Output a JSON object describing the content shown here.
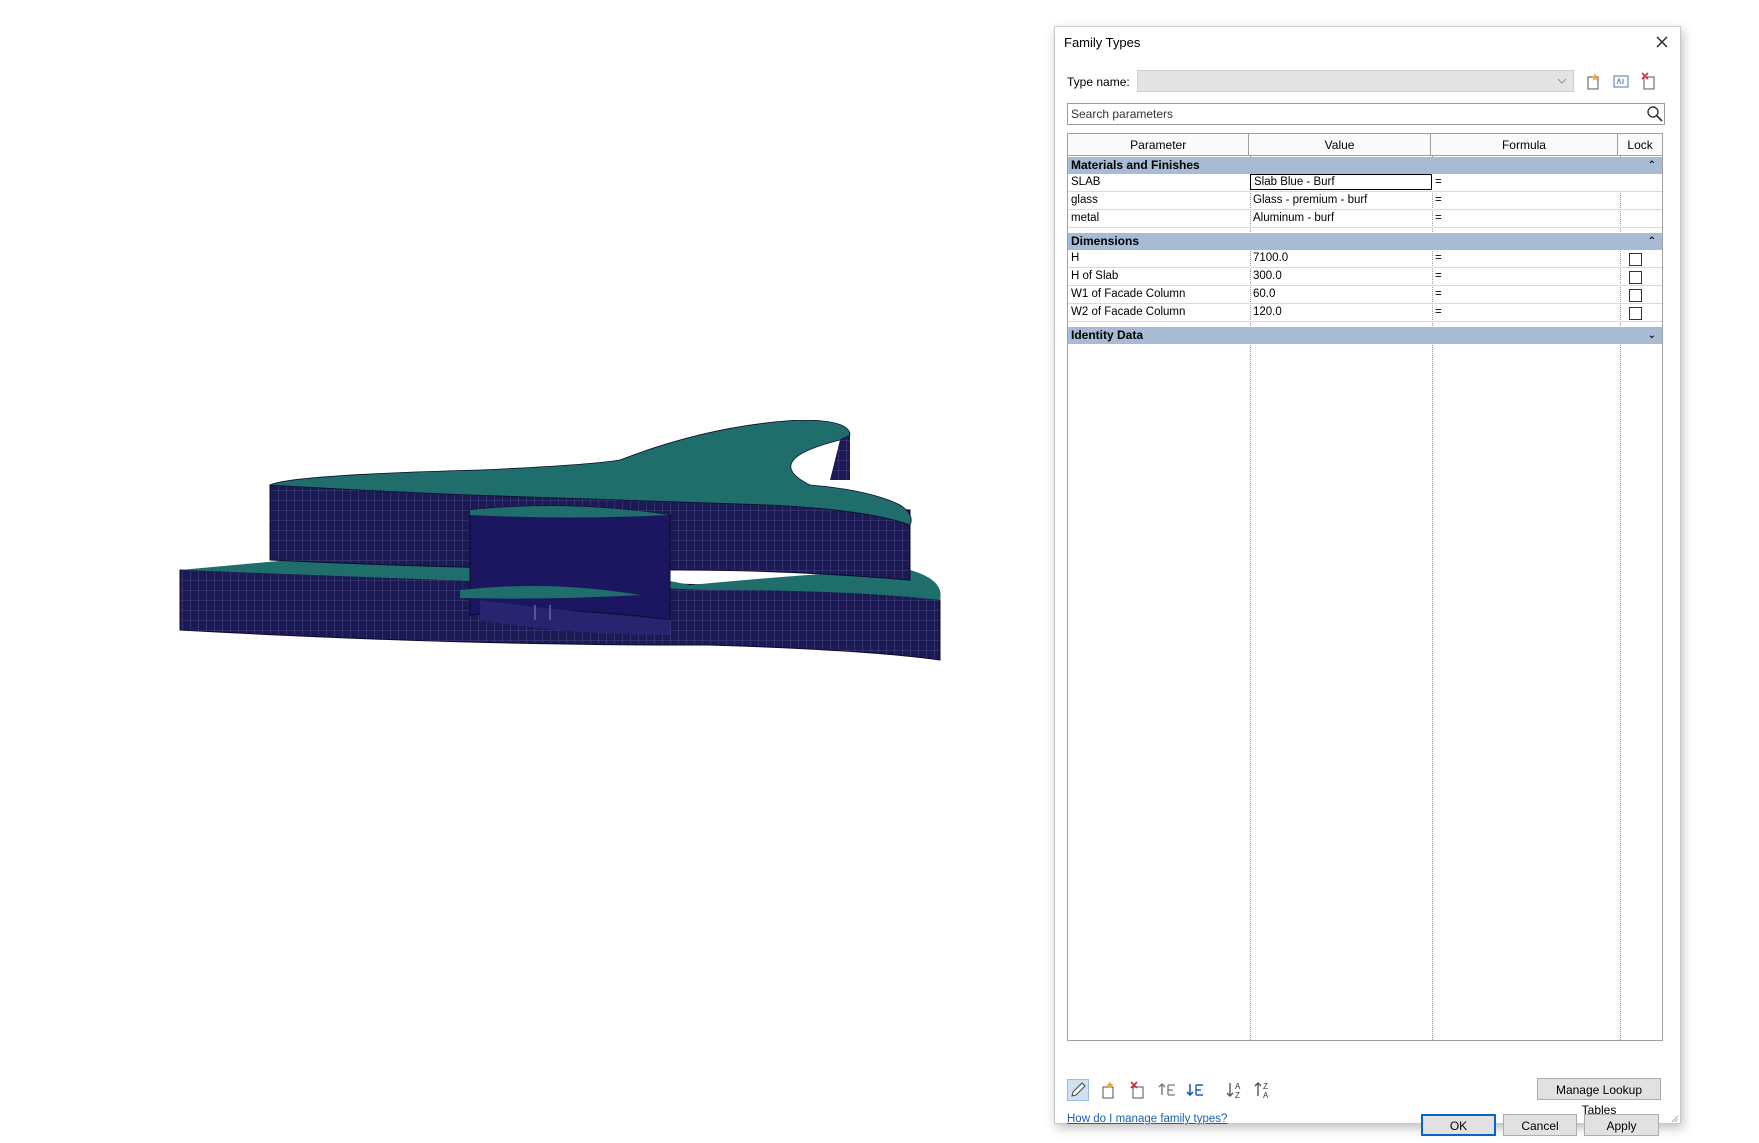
{
  "dialog": {
    "title": "Family Types",
    "type_name_label": "Type name:",
    "type_name_value": "",
    "search_placeholder": "Search parameters"
  },
  "columns": [
    "Parameter",
    "Value",
    "Formula",
    "Lock"
  ],
  "groups": [
    {
      "name": "Materials and Finishes",
      "expanded": true,
      "rows": [
        {
          "param": "SLAB",
          "value": "Slab Blue - Burf",
          "formula": "=",
          "lock": null,
          "selected": true
        },
        {
          "param": "glass",
          "value": "Glass - premium - burf",
          "formula": "=",
          "lock": null
        },
        {
          "param": "metal",
          "value": "Aluminum - burf",
          "formula": "=",
          "lock": null
        }
      ]
    },
    {
      "name": "Dimensions",
      "expanded": true,
      "rows": [
        {
          "param": "H",
          "value": "7100.0",
          "formula": "=",
          "lock": false
        },
        {
          "param": "H of Slab",
          "value": "300.0",
          "formula": "=",
          "lock": false
        },
        {
          "param": "W1 of Facade Column",
          "value": "60.0",
          "formula": "=",
          "lock": false
        },
        {
          "param": "W2 of Facade Column",
          "value": "120.0",
          "formula": "=",
          "lock": false
        }
      ]
    },
    {
      "name": "Identity Data",
      "expanded": false,
      "rows": []
    }
  ],
  "buttons": {
    "manage_lookup": "Manage Lookup Tables",
    "ok": "OK",
    "cancel": "Cancel",
    "apply": "Apply",
    "help_link": "How do I manage family types?"
  },
  "icons": {
    "close": "close-icon",
    "new_type": "new-type-icon",
    "rename_type": "rename-type-icon",
    "delete_type": "delete-type-icon",
    "search": "search-icon"
  },
  "colors": {
    "group_header": "#a7bcd4",
    "roof": "#1f6e6b",
    "facade": "#1c1a55",
    "ok_border": "#0a64c8",
    "link": "#1a5fb4"
  }
}
